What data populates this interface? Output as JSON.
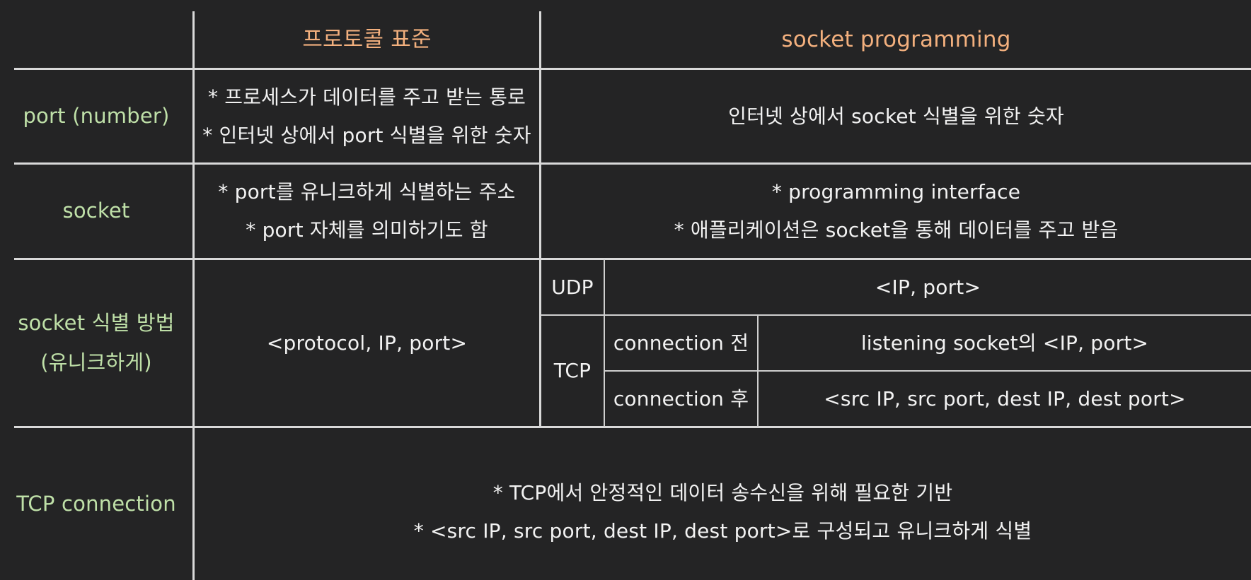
{
  "colors": {
    "background": "#242425",
    "grid_line": "#d9d9d9",
    "header_text": "#f3b07e",
    "row_label_text": "#bfe0a8",
    "body_text": "#f2f2f2"
  },
  "header": {
    "protocol_standard": "프로토콜 표준",
    "socket_programming": "socket programming"
  },
  "rows": {
    "port": {
      "label": "port (number)",
      "protocol_lines": [
        "* 프로세스가 데이터를 주고 받는 통로",
        "* 인터넷 상에서 port 식별을 위한 숫자"
      ],
      "socket_text": "인터넷 상에서 socket 식별을 위한 숫자"
    },
    "socket": {
      "label": "socket",
      "protocol_lines": [
        "* port를 유니크하게 식별하는 주소",
        "* port 자체를 의미하기도 함"
      ],
      "socket_lines": [
        "* programming interface",
        "* 애플리케이션은 socket을 통해 데이터를 주고 받음"
      ]
    },
    "identification": {
      "label_lines": [
        "socket 식별 방법",
        "(유니크하게)"
      ],
      "protocol_text": "<protocol, IP, port>",
      "udp_label": "UDP",
      "udp_value": "<IP, port>",
      "tcp_label": "TCP",
      "tcp_before_label": "connection 전",
      "tcp_before_value": "listening socket의 <IP, port>",
      "tcp_after_label": "connection 후",
      "tcp_after_value": "<src IP, src port, dest IP, dest port>"
    },
    "tcp_connection": {
      "label": "TCP connection",
      "lines": [
        "* TCP에서 안정적인 데이터 송수신을 위해 필요한 기반",
        "* <src IP, src port, dest IP, dest port>로 구성되고 유니크하게 식별"
      ]
    }
  }
}
